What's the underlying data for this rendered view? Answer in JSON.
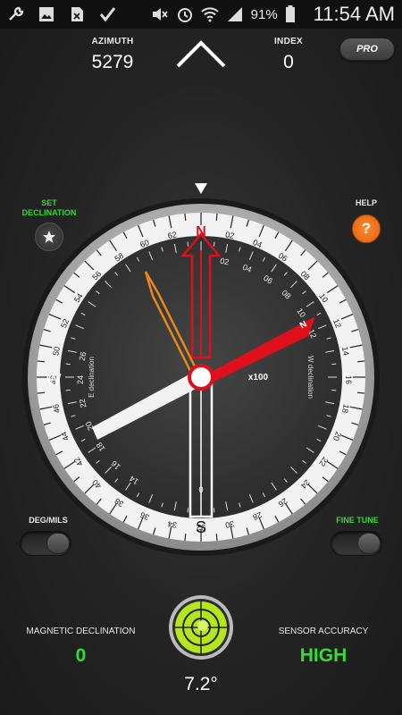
{
  "status": {
    "battery": "91%",
    "time": "11:54 AM",
    "icons": [
      "wrench-icon",
      "image-icon",
      "sim-icon",
      "check-icon",
      "mute-icon",
      "alarm-icon",
      "wifi-icon",
      "signal-icon",
      "battery-icon"
    ]
  },
  "azimuth": {
    "label": "AZIMUTH",
    "value": "5279"
  },
  "index": {
    "label": "INDEX",
    "value": "0"
  },
  "pro_label": "PRO",
  "set_declination": {
    "line1": "SET",
    "line2": "DECLINATION"
  },
  "help_label": "HELP",
  "help_icon": "?",
  "deg_mils_label": "DEG/MILS",
  "fine_tune_label": "FINE TUNE",
  "magnetic_declination": {
    "label": "MAGNETIC DECLINATION",
    "value": "0"
  },
  "sensor_accuracy": {
    "label": "SENSOR ACCURACY",
    "value": "HIGH"
  },
  "tilt_angle": "7.2°",
  "compass": {
    "north": "N",
    "south": "S",
    "east": "E",
    "west": "W",
    "multiplier": "x100",
    "e_declination_label": "E declination",
    "w_declination_label": "W declination",
    "needle_label": "N",
    "bezel_center_value": "0",
    "mils_labels": [
      "02",
      "04",
      "06",
      "08",
      "10",
      "12",
      "14",
      "16",
      "18",
      "20",
      "22",
      "24",
      "26",
      "28",
      "30",
      "32",
      "34",
      "36",
      "38",
      "40",
      "42",
      "44",
      "46",
      "48",
      "50",
      "52",
      "54",
      "56",
      "58",
      "60",
      "62",
      "0"
    ],
    "inner_labels_east": [
      "02",
      "04",
      "06",
      "08",
      "10",
      "12"
    ],
    "inner_labels_west": [
      "14",
      "16",
      "18",
      "20",
      "22",
      "24",
      "26"
    ]
  },
  "colors": {
    "accent_green": "#33dd33",
    "needle_red": "#e0101a",
    "help_orange": "#f07a1c"
  }
}
